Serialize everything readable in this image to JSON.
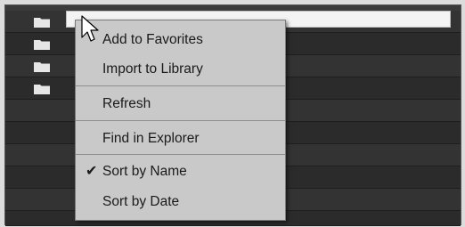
{
  "browser": {
    "rows": [
      {
        "has_folder": true
      },
      {
        "has_folder": true
      },
      {
        "has_folder": true
      },
      {
        "has_folder": true
      },
      {
        "has_folder": false
      },
      {
        "has_folder": false
      },
      {
        "has_folder": false
      },
      {
        "has_folder": false
      },
      {
        "has_folder": false
      }
    ],
    "rename_value": ""
  },
  "context_menu": {
    "items": [
      {
        "label": "Add to Favorites",
        "checked": false
      },
      {
        "label": "Import to Library",
        "checked": false
      },
      {
        "label": "Refresh",
        "checked": false
      },
      {
        "label": "Find in Explorer",
        "checked": false
      },
      {
        "label": "Sort by Name",
        "checked": true
      },
      {
        "label": "Sort by Date",
        "checked": false
      }
    ],
    "check_glyph": "✔"
  },
  "icons": {
    "folder": "folder-icon",
    "cursor": "mouse-pointer-icon",
    "check": "checkmark-icon"
  },
  "colors": {
    "panel_bg": "#262626",
    "menu_bg": "#c9c9c9",
    "menu_text": "#1a1a1a",
    "folder": "#e6e6e6"
  }
}
